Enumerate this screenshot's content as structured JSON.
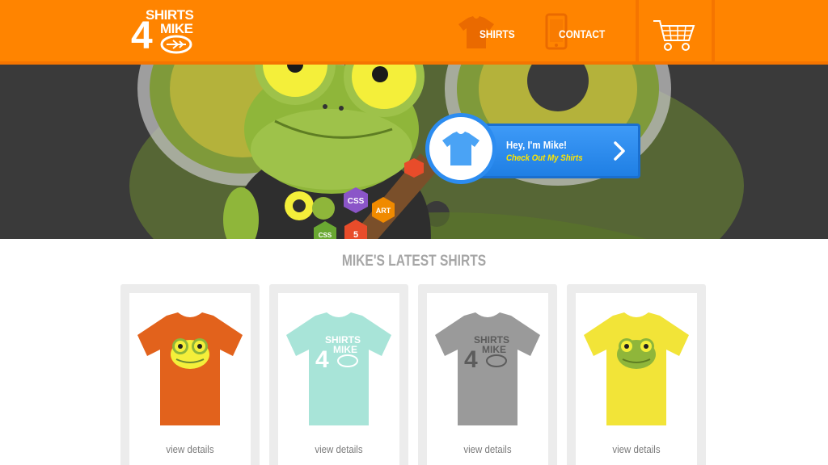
{
  "header": {
    "logo_line1": "SHIRTS",
    "logo_line2": "MIKE",
    "logo_numeral": "4",
    "nav": [
      {
        "label": "SHIRTS",
        "icon": "tshirt-icon"
      },
      {
        "label": "CONTACT",
        "icon": "phone-icon"
      }
    ],
    "cart_icon": "shopping-cart-icon"
  },
  "hero": {
    "cta_title": "Hey, I'm Mike!",
    "cta_subtitle": "Check Out My Shirts",
    "badges": [
      "CSS",
      "ART",
      "CSS",
      "5"
    ]
  },
  "latest": {
    "title": "MIKE'S LATEST SHIRTS",
    "products": [
      {
        "color": "#e2621c",
        "design": "frog-face",
        "link": "view details"
      },
      {
        "color": "#a8e4d8",
        "design": "shirts-4-mike-logo",
        "link": "view details"
      },
      {
        "color": "#9a9a9a",
        "design": "shirts-4-mike-logo",
        "link": "view details"
      },
      {
        "color": "#f2e438",
        "design": "frog-face",
        "link": "view details"
      }
    ]
  },
  "colors": {
    "brand_orange": "#ff8400",
    "cta_blue": "#2c8cf0",
    "cta_yellow": "#ffe500",
    "frog_green": "#8fb63a"
  }
}
